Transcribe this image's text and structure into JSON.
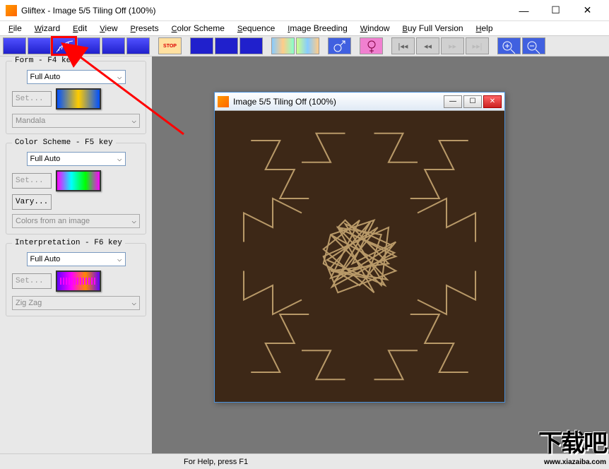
{
  "title": "Gliftex -  Image 5/5 Tiling Off (100%)",
  "menus": [
    "File",
    "Wizard",
    "Edit",
    "View",
    "Presets",
    "Color Scheme",
    "Sequence",
    "Image Breeding",
    "Window",
    "Buy Full Version",
    "Help"
  ],
  "form": {
    "title": "Form - F4 key",
    "mode": "Full Auto",
    "set": "Set...",
    "preset": "Mandala"
  },
  "color": {
    "title": "Color Scheme - F5 key",
    "mode": "Full Auto",
    "set": "Set...",
    "vary": "Vary...",
    "preset": "Colors from an image"
  },
  "interp": {
    "title": "Interpretation - F6 key",
    "mode": "Full Auto",
    "set": "Set...",
    "preset": "Zig Zag"
  },
  "child_title": "Image 5/5 Tiling Off (100%)",
  "status": "For Help, press F1",
  "nav": {
    "first": "|◂◂",
    "prev": "◂◂",
    "next": "▸▸",
    "last": "▸▸|"
  },
  "watermark": {
    "big": "下载吧",
    "url": "www.xiazaiba.com"
  }
}
